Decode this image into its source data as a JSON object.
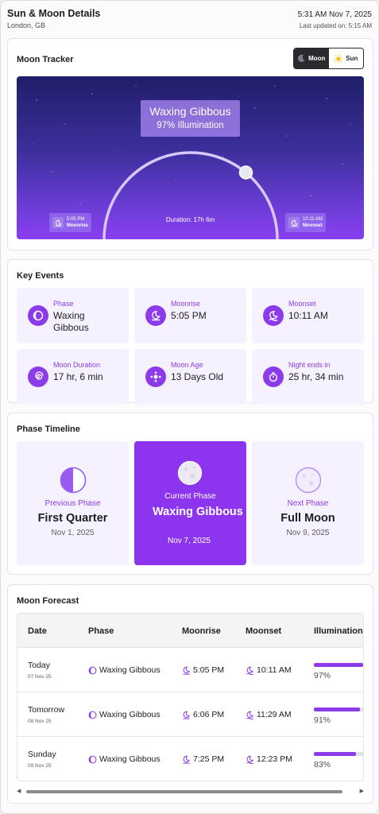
{
  "header": {
    "title": "Sun & Moon Details",
    "location": "London, GB",
    "datetime": "5:31 AM Nov 7, 2025",
    "updated": "Last updated on: 5:15 AM"
  },
  "tracker": {
    "title": "Moon Tracker",
    "toggle": {
      "moon": "Moon",
      "sun": "Sun",
      "selected": "Moon"
    },
    "phase_name": "Waxing Gibbous",
    "illumination": "97% Illumination",
    "moonrise_time": "5:05 PM",
    "moonrise_label": "Moonrise",
    "moonset_time": "10:11 AM",
    "moonset_label": "Moonset",
    "duration": "Duration: 17h 6m",
    "arc_progress": 0.72
  },
  "key_events": {
    "title": "Key Events",
    "items": [
      {
        "label": "Phase",
        "value": "Waxing Gibbous",
        "icon": "crescent-icon"
      },
      {
        "label": "Moonrise",
        "value": "5:05 PM",
        "icon": "moonrise-icon"
      },
      {
        "label": "Moonset",
        "value": "10:11 AM",
        "icon": "moonset-icon"
      },
      {
        "label": "Moon Duration",
        "value": "17 hr, 6 min",
        "icon": "spiral-icon"
      },
      {
        "label": "Moon Age",
        "value": "13 Days Old",
        "icon": "orbit-icon"
      },
      {
        "label": "Night ends in",
        "value": "25 hr, 34 min",
        "icon": "timer-icon"
      }
    ]
  },
  "timeline": {
    "title": "Phase Timeline",
    "previous": {
      "kicker": "Previous Phase",
      "name": "First Quarter",
      "date": "Nov 1, 2025"
    },
    "current": {
      "kicker": "Current Phase",
      "name": "Waxing Gibbous",
      "date": "Nov 7, 2025"
    },
    "next": {
      "kicker": "Next Phase",
      "name": "Full Moon",
      "date": "Nov 9, 2025"
    }
  },
  "forecast": {
    "title": "Moon Forecast",
    "columns": [
      "Date",
      "Phase",
      "Moonrise",
      "Moonset",
      "Illumination"
    ],
    "rows": [
      {
        "day": "Today",
        "date": "07 Nov 25",
        "phase": "Waxing Gibbous",
        "moonrise": "5:05 PM",
        "moonset": "10:11 AM",
        "illumination": "97%",
        "illum_value": 0.97
      },
      {
        "day": "Tomorrow",
        "date": "08 Nov 25",
        "phase": "Waxing Gibbous",
        "moonrise": "6:06 PM",
        "moonset": "11:29 AM",
        "illumination": "91%",
        "illum_value": 0.91
      },
      {
        "day": "Sunday",
        "date": "09 Nov 25",
        "phase": "Waxing Gibbous",
        "moonrise": "7:25 PM",
        "moonset": "12:23 PM",
        "illumination": "83%",
        "illum_value": 0.83
      }
    ]
  },
  "colors": {
    "accent": "#8c3bea",
    "accent_light": "#f6f1fe",
    "sky_top": "#201e6a",
    "sky_bottom": "#8a3ff0"
  }
}
